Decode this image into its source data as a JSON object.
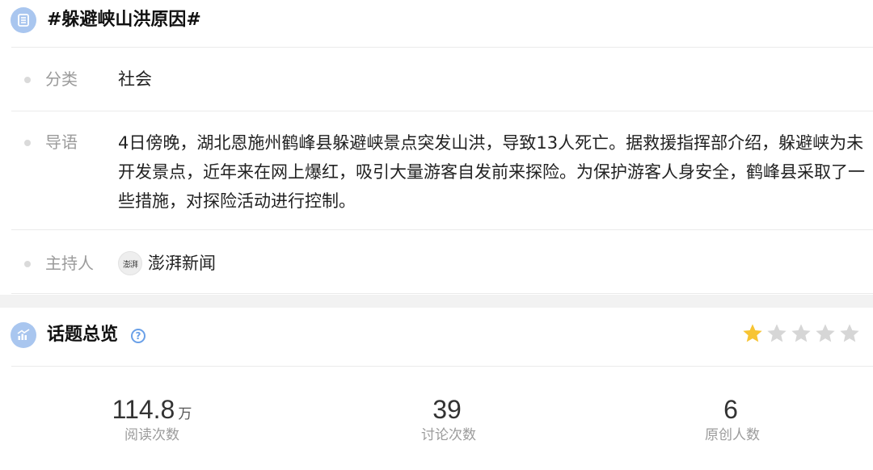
{
  "topic": {
    "title": "#躲避峡山洪原因#",
    "category_label": "分类",
    "category_value": "社会",
    "intro_label": "导语",
    "intro_text": "4日傍晚，湖北恩施州鹤峰县躲避峡景点突发山洪，导致13人死亡。据救援指挥部介绍，躲避峡为未开发景点，近年来在网上爆红，吸引大量游客自发前来探险。为保护游客人身安全，鹤峰县采取了一些措施，对探险活动进行控制。",
    "host_label": "主持人",
    "host_logo_text": "澎湃",
    "host_name": "澎湃新闻"
  },
  "overview": {
    "title": "话题总览",
    "help_icon": "question-circle-icon",
    "rating": 1,
    "rating_max": 5,
    "stats": [
      {
        "value": "114.8",
        "unit": "万",
        "label": "阅读次数"
      },
      {
        "value": "39",
        "unit": "",
        "label": "讨论次数"
      },
      {
        "value": "6",
        "unit": "",
        "label": "原创人数"
      }
    ]
  },
  "colors": {
    "accent": "#6aa0e8",
    "icon_bg": "#a9c6ef",
    "star_on": "#f7c433",
    "star_off": "#d6d6d6"
  }
}
